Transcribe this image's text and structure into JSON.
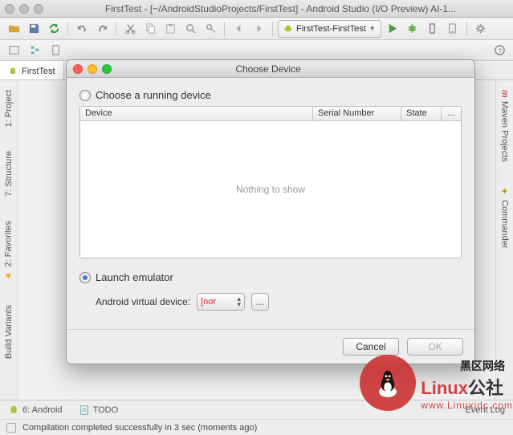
{
  "window": {
    "title": "FirstTest - [~/AndroidStudioProjects/FirstTest] - Android Studio (I/O Preview) AI-1..."
  },
  "run_config": {
    "label": "FirstTest-FirstTest"
  },
  "tabs": [
    {
      "label": "FirstTest"
    }
  ],
  "left_panel": [
    {
      "label": "1: Project"
    },
    {
      "label": "7: Structure"
    },
    {
      "label": "2: Favorites"
    },
    {
      "label": "Build Variants"
    }
  ],
  "right_panel": [
    {
      "label": "Maven Projects"
    },
    {
      "label": "Commander"
    }
  ],
  "bottom_tools": [
    {
      "label": "6: Android"
    },
    {
      "label": "TODO"
    },
    {
      "label": "Event Log"
    }
  ],
  "status": {
    "message": "Compilation completed successfully in 3 sec (moments ago)"
  },
  "dialog": {
    "title": "Choose Device",
    "option_running": "Choose a running device",
    "option_launch": "Launch emulator",
    "columns": {
      "device": "Device",
      "serial": "Serial Number",
      "state": "State",
      "more": "..."
    },
    "empty": "Nothing to show",
    "avd_label": "Android virtual device:",
    "avd_value": "[nor",
    "cancel": "Cancel",
    "ok": "OK"
  },
  "watermark": {
    "brand_en": "Linux",
    "brand_cn": "黑区网络",
    "url": "www.Linuxidc.com"
  }
}
